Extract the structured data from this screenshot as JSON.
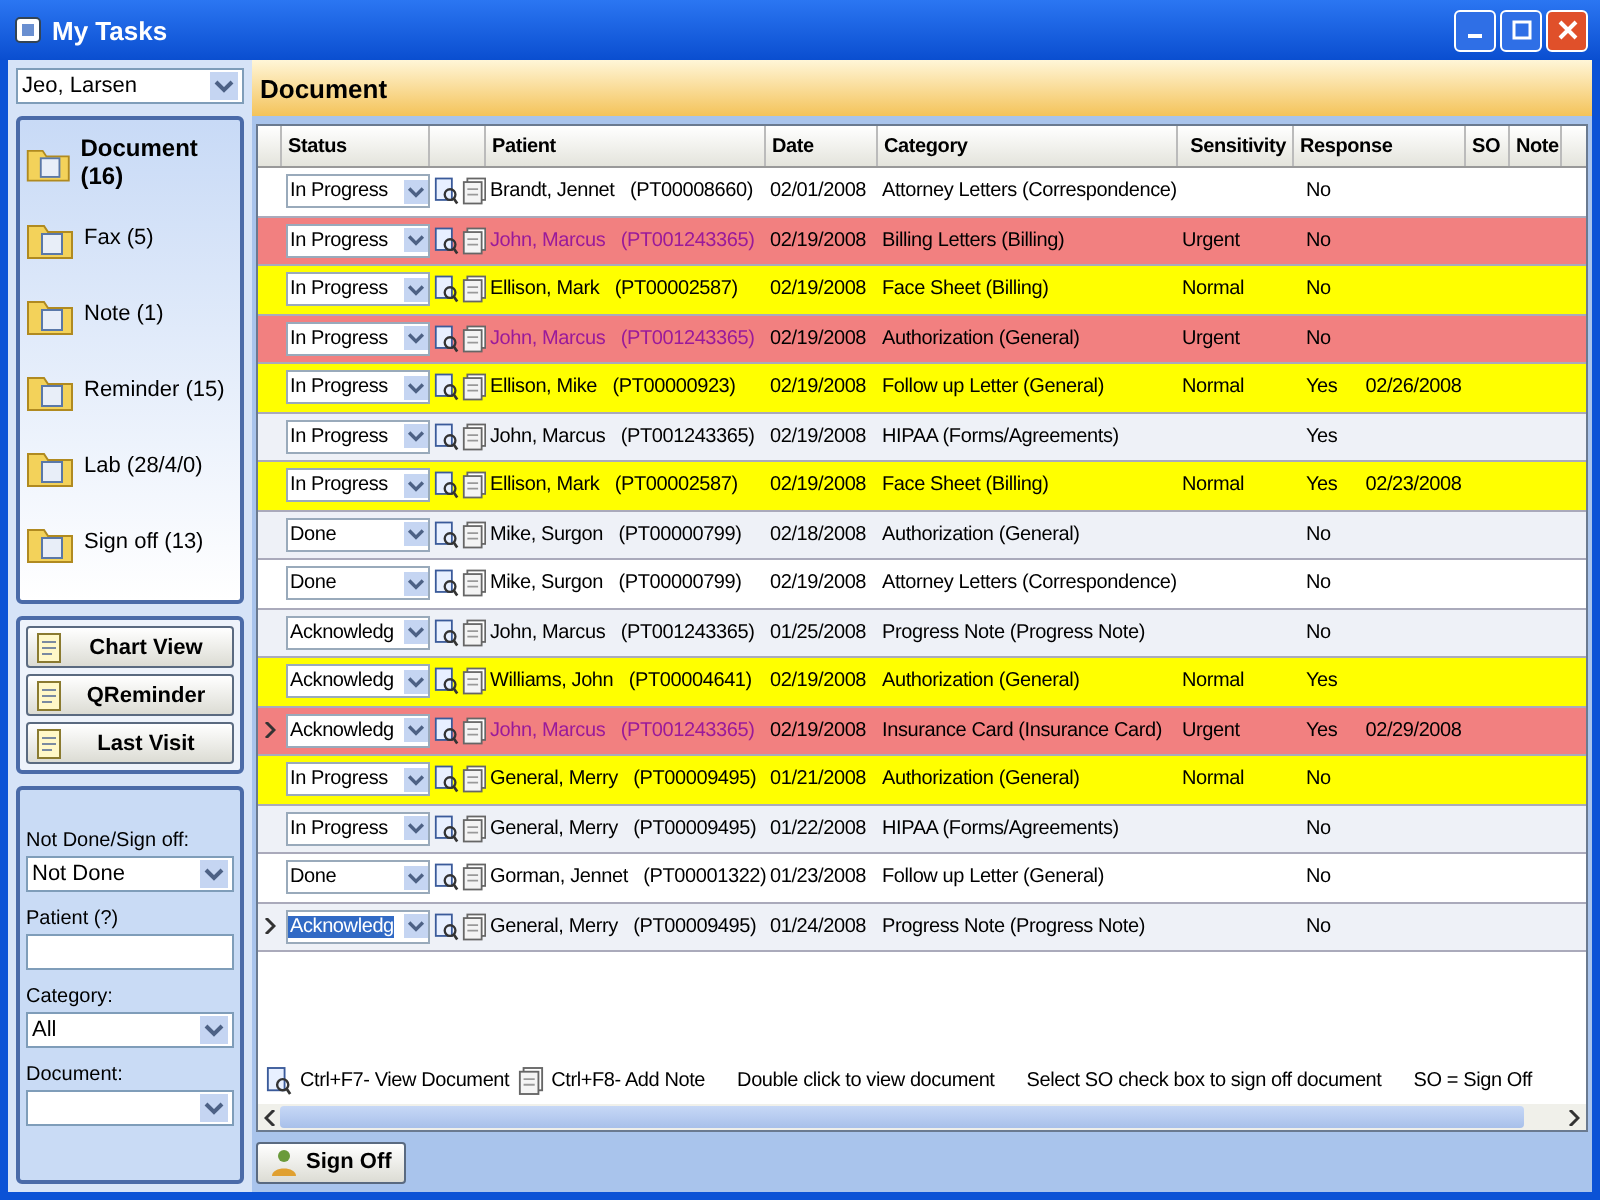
{
  "window": {
    "title": "My Tasks"
  },
  "sidebar": {
    "user": "Jeo, Larsen",
    "nav_items": [
      {
        "label": "Document (16)",
        "selected": true
      },
      {
        "label": "Fax (5)",
        "selected": false
      },
      {
        "label": "Note (1)",
        "selected": false
      },
      {
        "label": "Reminder (15)",
        "selected": false
      },
      {
        "label": "Lab (28/4/0)",
        "selected": false
      },
      {
        "label": "Sign off (13)",
        "selected": false
      }
    ],
    "buttons": [
      {
        "label": "Chart View"
      },
      {
        "label": "QReminder"
      },
      {
        "label": "Last Visit"
      }
    ],
    "filters": [
      {
        "label": "Not Done/Sign off:",
        "kind": "select",
        "value": "Not Done"
      },
      {
        "label": "Patient (?)",
        "kind": "text"
      },
      {
        "label": "Category:",
        "kind": "select",
        "value": "All"
      },
      {
        "label": "Document:",
        "kind": "select"
      }
    ]
  },
  "panel": {
    "title": "Document"
  },
  "table": {
    "columns": [
      "Status",
      "Patient",
      "Date",
      "Category",
      "Sensitivity",
      "Response",
      "SO",
      "Note"
    ],
    "rows": [
      {
        "status": "In Progress",
        "selected": false,
        "pointer": false,
        "patient": "Brandt, Jennet",
        "patient_id": "(PT00008660)",
        "date": "02/01/2008",
        "category": "Attorney Letters (Correspondence)",
        "response": "No"
      },
      {
        "status": "In Progress",
        "selected": false,
        "pointer": false,
        "color": "#f28080",
        "patient": "John, Marcus",
        "patient_id": "(PT001243365)",
        "date": "02/19/2008",
        "category": "Billing Letters (Billing)",
        "sensitivity": "Urgent",
        "response": "No"
      },
      {
        "status": "In Progress",
        "selected": false,
        "pointer": false,
        "color": "#ffff00",
        "patient": "Ellison, Mark",
        "patient_id": "(PT00002587)",
        "date": "02/19/2008",
        "category": "Face Sheet (Billing)",
        "sensitivity": "Normal",
        "response": "No"
      },
      {
        "status": "In Progress",
        "selected": false,
        "pointer": false,
        "color": "#f28080",
        "patient": "John, Marcus",
        "patient_id": "(PT001243365)",
        "date": "02/19/2008",
        "category": "Authorization (General)",
        "sensitivity": "Urgent",
        "response": "No"
      },
      {
        "status": "In Progress",
        "selected": false,
        "pointer": false,
        "color": "#ffff00",
        "patient": "Ellison, Mike",
        "patient_id": "(PT00000923)",
        "date": "02/19/2008",
        "category": "Follow up Letter (General)",
        "sensitivity": "Normal",
        "response": "Yes",
        "response_date": "02/26/2008"
      },
      {
        "status": "In Progress",
        "selected": false,
        "pointer": false,
        "patient": "John, Marcus",
        "patient_id": "(PT001243365)",
        "date": "02/19/2008",
        "category": "HIPAA (Forms/Agreements)",
        "response": "Yes"
      },
      {
        "status": "In Progress",
        "selected": false,
        "pointer": false,
        "color": "#ffff00",
        "patient": "Ellison, Mark",
        "patient_id": "(PT00002587)",
        "date": "02/19/2008",
        "category": "Face Sheet (Billing)",
        "sensitivity": "Normal",
        "response": "Yes",
        "response_date": "02/23/2008"
      },
      {
        "status": "Done",
        "selected": false,
        "pointer": false,
        "patient": "Mike, Surgon",
        "patient_id": "(PT00000799)",
        "date": "02/18/2008",
        "category": "Authorization (General)",
        "response": "No"
      },
      {
        "status": "Done",
        "selected": false,
        "pointer": false,
        "patient": "Mike, Surgon",
        "patient_id": "(PT00000799)",
        "date": "02/19/2008",
        "category": "Attorney Letters (Correspondence)",
        "response": "No"
      },
      {
        "status": "Acknowledg",
        "selected": false,
        "pointer": false,
        "patient": "John, Marcus",
        "patient_id": "(PT001243365)",
        "date": "01/25/2008",
        "category": "Progress Note (Progress Note)",
        "response": "No"
      },
      {
        "status": "Acknowledg",
        "selected": false,
        "pointer": false,
        "color": "#ffff00",
        "patient": "Williams, John",
        "patient_id": "(PT00004641)",
        "date": "02/19/2008",
        "category": "Authorization (General)",
        "sensitivity": "Normal",
        "response": "Yes"
      },
      {
        "status": "Acknowledg",
        "selected": false,
        "pointer": true,
        "color": "#f28080",
        "patient": "John, Marcus",
        "patient_id": "(PT001243365)",
        "date": "02/19/2008",
        "category": "Insurance Card (Insurance Card)",
        "sensitivity": "Urgent",
        "response": "Yes",
        "response_date": "02/29/2008"
      },
      {
        "status": "In Progress",
        "selected": false,
        "pointer": false,
        "color": "#ffff00",
        "patient": "General, Merry",
        "patient_id": "(PT00009495)",
        "date": "01/21/2008",
        "category": "Authorization (General)",
        "sensitivity": "Normal",
        "response": "No"
      },
      {
        "status": "In Progress",
        "selected": false,
        "pointer": false,
        "patient": "General, Merry",
        "patient_id": "(PT00009495)",
        "date": "01/22/2008",
        "category": "HIPAA (Forms/Agreements)",
        "response": "No"
      },
      {
        "status": "Done",
        "selected": false,
        "pointer": false,
        "patient": "Gorman, Jennet",
        "patient_id": "(PT00001322)",
        "date": "01/23/2008",
        "category": "Follow up Letter (General)",
        "response": "No"
      },
      {
        "status": "Acknowledg",
        "selected": true,
        "pointer": true,
        "patient": "General, Merry",
        "patient_id": "(PT00009495)",
        "date": "01/24/2008",
        "category": "Progress Note (Progress Note)",
        "response": "No"
      }
    ]
  },
  "legend": [
    {
      "kind": "view",
      "text": "Ctrl+F7- View Document"
    },
    {
      "kind": "note",
      "text": "Ctrl+F8- Add Note"
    },
    {
      "kind": "plain",
      "text": "Double click to view document"
    },
    {
      "kind": "plain",
      "text": "Select SO check box to sign off document"
    },
    {
      "kind": "plain",
      "text": "SO = Sign Off"
    }
  ],
  "sign_off_button": "Sign Off"
}
